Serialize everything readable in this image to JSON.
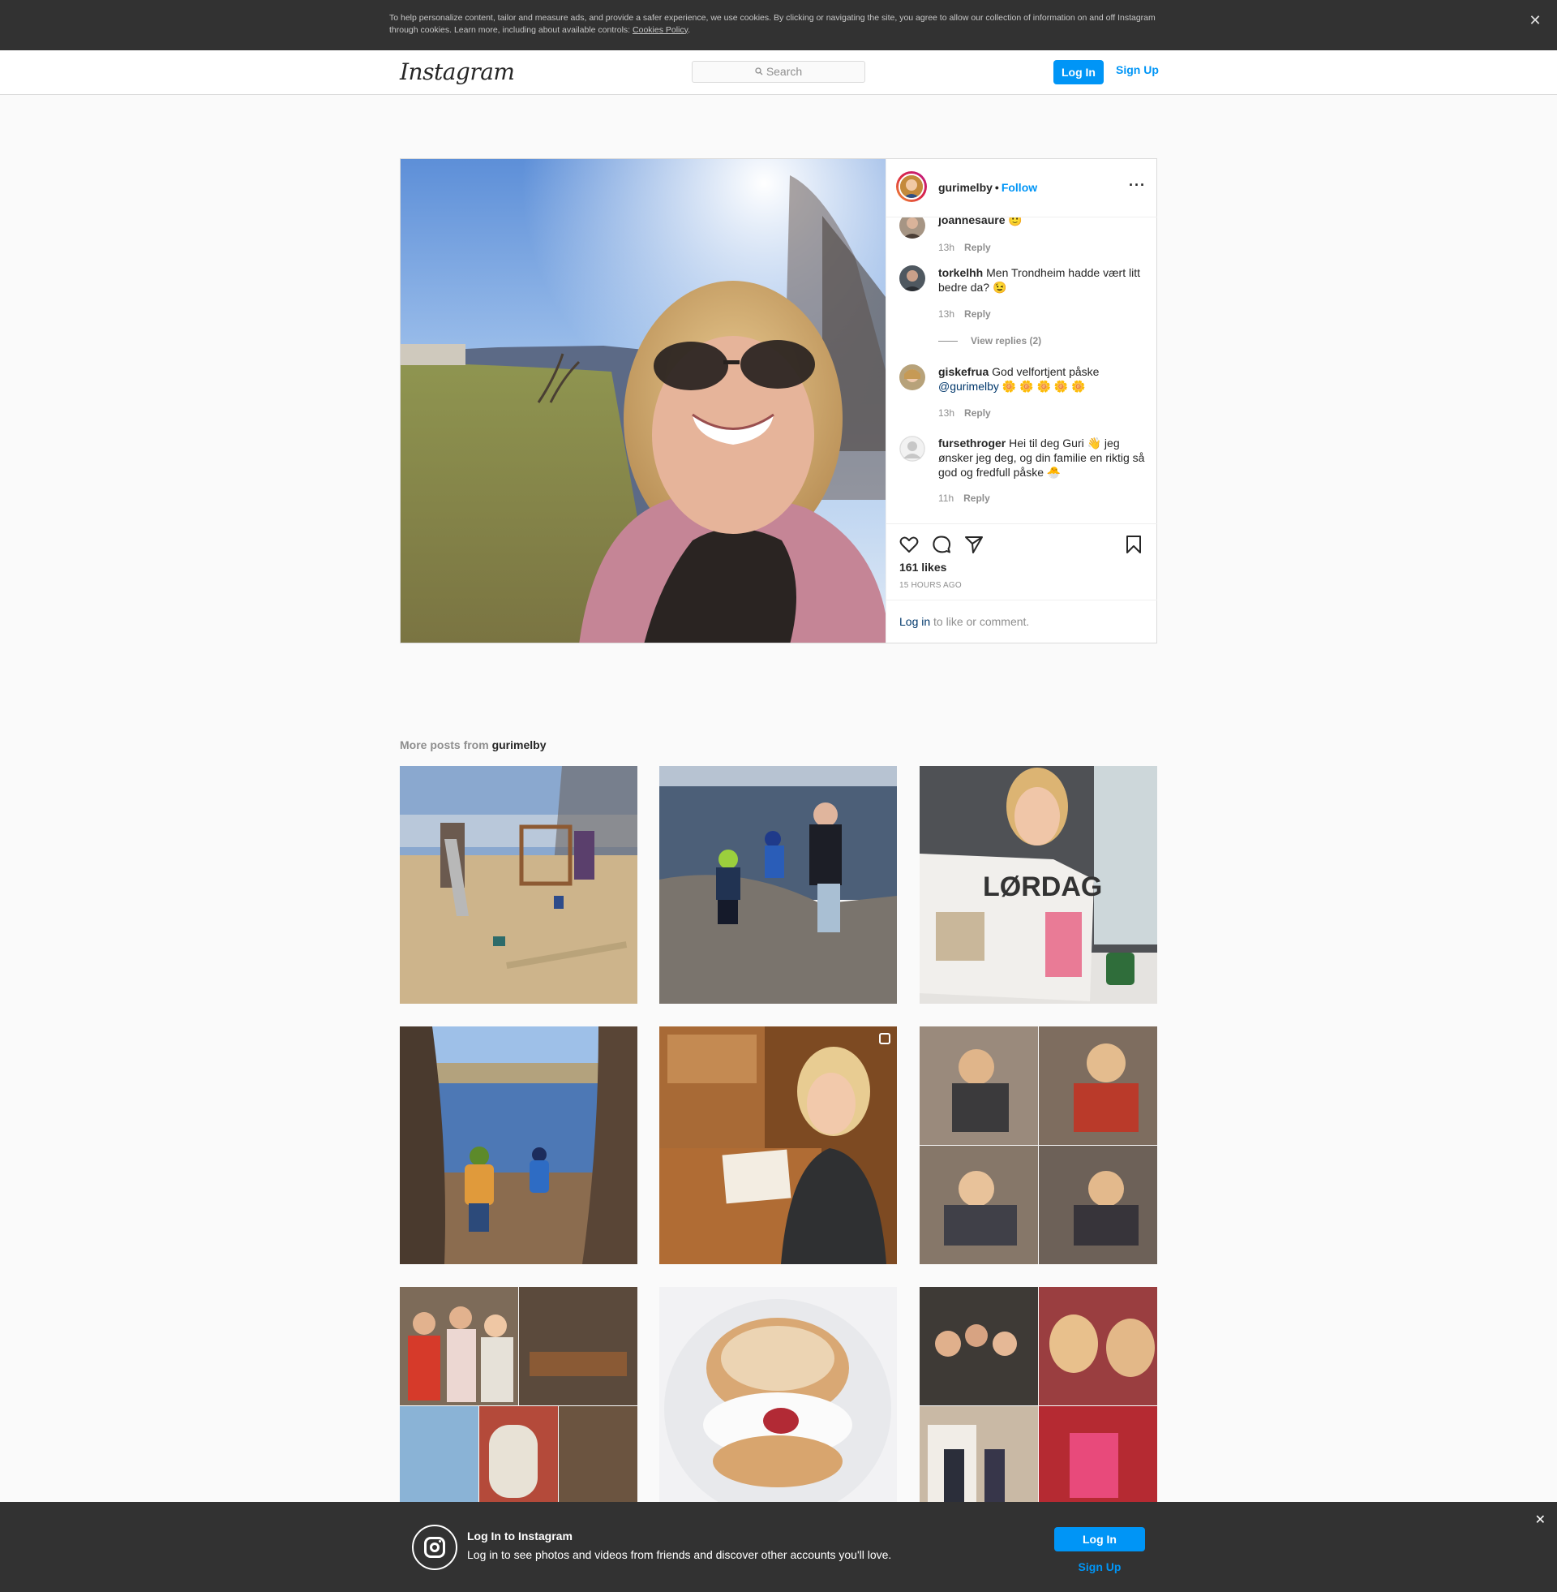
{
  "cookie_banner": {
    "text": "To help personalize content, tailor and measure ads, and provide a safer experience, we use cookies. By clicking or navigating the site, you agree to allow our collection of information on and off Instagram through cookies. Learn more, including about available controls: ",
    "link": "Cookies Policy",
    "period": ".",
    "close": "✕"
  },
  "nav": {
    "logo": "Instagram",
    "search_placeholder": "Search",
    "login": "Log In",
    "signup": "Sign Up"
  },
  "post": {
    "username": "gurimelby",
    "dot": "•",
    "follow": "Follow",
    "more": "···",
    "likes": "161 likes",
    "time": "15 HOURS AGO",
    "login_link": "Log in",
    "login_rest": " to like or comment.",
    "comments": [
      {
        "user": "joannesaure",
        "text": " 🙂",
        "time": "13h",
        "reply": "Reply"
      },
      {
        "user": "torkelhh",
        "text": " Men Trondheim hadde vært litt bedre da? 😉",
        "time": "13h",
        "reply": "Reply",
        "view_replies": "View replies (2)"
      },
      {
        "user": "giskefrua",
        "text": " God velfortjent påske ",
        "mention": "@gurimelby",
        "after_mention": " 🌼 🌼 🌼 🌼 🌼",
        "time": "13h",
        "reply": "Reply"
      },
      {
        "user": "fursethroger",
        "text": " Hei til deg Guri 👋 jeg ønsker jeg deg, og din familie en riktig så god og fredfull påske 🐣",
        "time": "11h",
        "reply": "Reply"
      }
    ]
  },
  "more_posts": {
    "label": "More posts from ",
    "user": "gurimelby",
    "thumbs": [
      "playground",
      "shore",
      "newspaper",
      "pond",
      "desk",
      "collage-family",
      "collage-friends",
      "bun",
      "collage-selfies"
    ]
  },
  "bottom_banner": {
    "title": "Log In to Instagram",
    "text": "Log in to see photos and videos from friends and discover other accounts you'll love.",
    "login": "Log In",
    "signup": "Sign Up",
    "close": "✕"
  },
  "colors": {
    "accent": "#0095f6",
    "banner_bg": "#323232",
    "link_dark": "#00376b"
  }
}
